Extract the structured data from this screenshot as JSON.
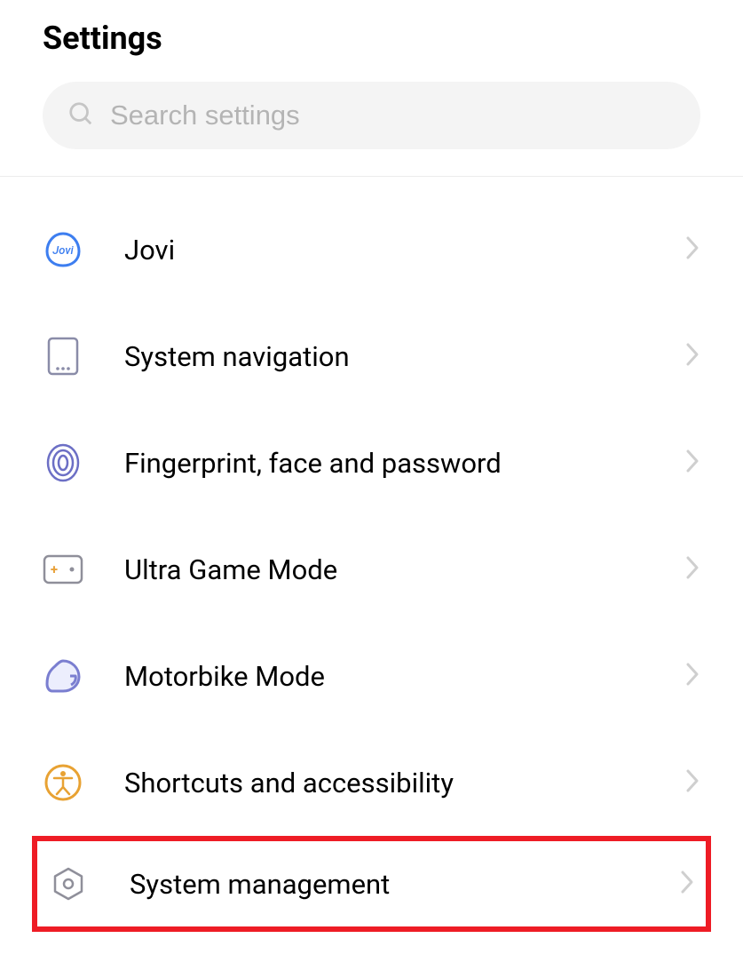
{
  "header": {
    "title": "Settings"
  },
  "search": {
    "placeholder": "Search settings"
  },
  "items": [
    {
      "label": "Jovi",
      "icon": "jovi"
    },
    {
      "label": "System navigation",
      "icon": "system-nav"
    },
    {
      "label": "Fingerprint, face and password",
      "icon": "fingerprint"
    },
    {
      "label": "Ultra Game Mode",
      "icon": "game"
    },
    {
      "label": "Motorbike Mode",
      "icon": "motorbike"
    },
    {
      "label": "Shortcuts and accessibility",
      "icon": "accessibility"
    },
    {
      "label": "System management",
      "icon": "system-mgmt",
      "highlighted": true
    }
  ]
}
